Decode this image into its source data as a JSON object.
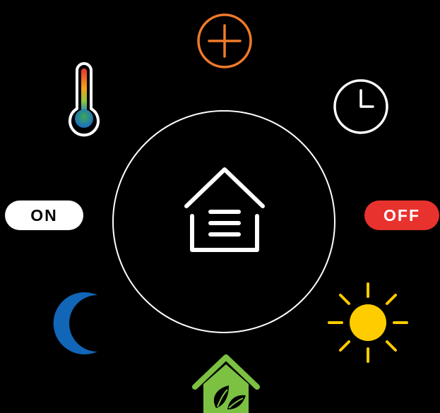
{
  "controls": {
    "on_label": "ON",
    "off_label": "OFF"
  },
  "icons": {
    "center": "smart-home-menu-icon",
    "top": "plus-icon",
    "top_left": "thermometer-icon",
    "top_right": "clock-icon",
    "bottom_left": "moon-icon",
    "bottom_right": "sun-icon",
    "bottom": "eco-home-leaf-icon"
  },
  "colors": {
    "background": "#000000",
    "ring": "#ffffff",
    "plus": "#f07a2a",
    "off": "#e8322e",
    "on": "#ffffff",
    "moon": "#1166b8",
    "sun": "#ffcc00",
    "eco": "#7cc142"
  }
}
